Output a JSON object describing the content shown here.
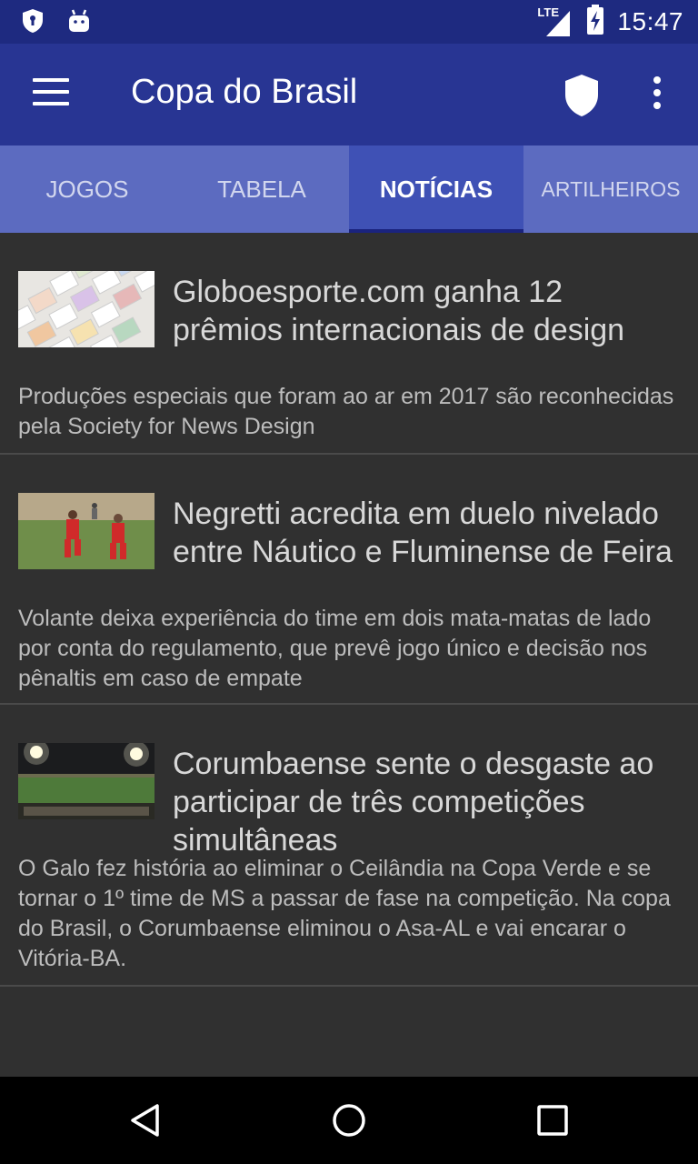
{
  "status_bar": {
    "time": "15:47",
    "network": "LTE",
    "icons": [
      "shield-notification-icon",
      "android-icon",
      "signal-icon",
      "battery-charging-icon"
    ]
  },
  "app_bar": {
    "title": "Copa do Brasil",
    "icons": [
      "menu-icon",
      "shield-icon",
      "more-vert-icon"
    ]
  },
  "tabs": [
    {
      "label": "JOGOS",
      "active": false
    },
    {
      "label": "TABELA",
      "active": false
    },
    {
      "label": "NOTÍCIAS",
      "active": true
    },
    {
      "label": "ARTILHEIROS",
      "active": false
    }
  ],
  "news": [
    {
      "headline": "Globoesporte.com ganha 12 prêmios internacionais de design",
      "summary": "Produções especiais que foram ao ar em 2017 são reconhecidas pela Society for News Design",
      "thumbnail": "design-pages-thumbnail"
    },
    {
      "headline": "Negretti acredita em duelo nivelado entre Náutico e Fluminense de Feira",
      "summary": "Volante deixa experiência do time em dois mata-matas de lado por conta do regulamento, que prevê jogo único e decisão nos pênaltis em caso de empate",
      "thumbnail": "players-training-thumbnail"
    },
    {
      "headline": "Corumbaense sente o desgaste ao participar de três competições simultâneas",
      "summary": "O Galo fez história ao eliminar o Ceilândia na Copa Verde e se tornar o 1º time de MS a passar de fase na competição. Na copa do Brasil, o Corumbaense eliminou o Asa-AL e vai encarar o Vitória-BA.",
      "thumbnail": "stadium-night-thumbnail"
    }
  ],
  "nav_bar": {
    "icons": [
      "back-icon",
      "home-icon",
      "recents-icon"
    ]
  },
  "colors": {
    "status_bar": "#1e2a80",
    "app_bar": "#283593",
    "tabs": "#5c6bc0",
    "tab_active": "#3f51b5",
    "background": "#303030"
  }
}
